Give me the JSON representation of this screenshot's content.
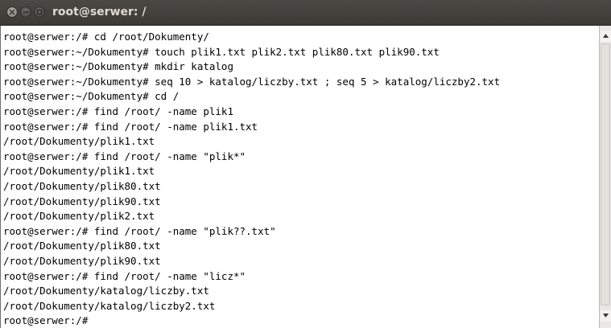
{
  "window": {
    "title": "root@serwer: /"
  },
  "titlebar_buttons": {
    "close_icon": "close-icon",
    "minimize_icon": "minimize-icon",
    "maximize_icon": "maximize-icon"
  },
  "terminal": {
    "lines": [
      "root@serwer:/# cd /root/Dokumenty/",
      "root@serwer:~/Dokumenty# touch plik1.txt plik2.txt plik80.txt plik90.txt",
      "root@serwer:~/Dokumenty# mkdir katalog",
      "root@serwer:~/Dokumenty# seq 10 > katalog/liczby.txt ; seq 5 > katalog/liczby2.txt",
      "root@serwer:~/Dokumenty# cd /",
      "root@serwer:/# find /root/ -name plik1",
      "root@serwer:/# find /root/ -name plik1.txt",
      "/root/Dokumenty/plik1.txt",
      "root@serwer:/# find /root/ -name \"plik*\"",
      "/root/Dokumenty/plik1.txt",
      "/root/Dokumenty/plik80.txt",
      "/root/Dokumenty/plik90.txt",
      "/root/Dokumenty/plik2.txt",
      "root@serwer:/# find /root/ -name \"plik??.txt\"",
      "/root/Dokumenty/plik80.txt",
      "/root/Dokumenty/plik90.txt",
      "root@serwer:/# find /root/ -name \"licz*\"",
      "/root/Dokumenty/katalog/liczby.txt",
      "/root/Dokumenty/katalog/liczby2.txt",
      "root@serwer:/# "
    ]
  },
  "colors": {
    "titlebar": "#3c3b37",
    "title_text": "#dfdbd2",
    "terminal_background": "#ffffff",
    "terminal_text": "#000000"
  }
}
